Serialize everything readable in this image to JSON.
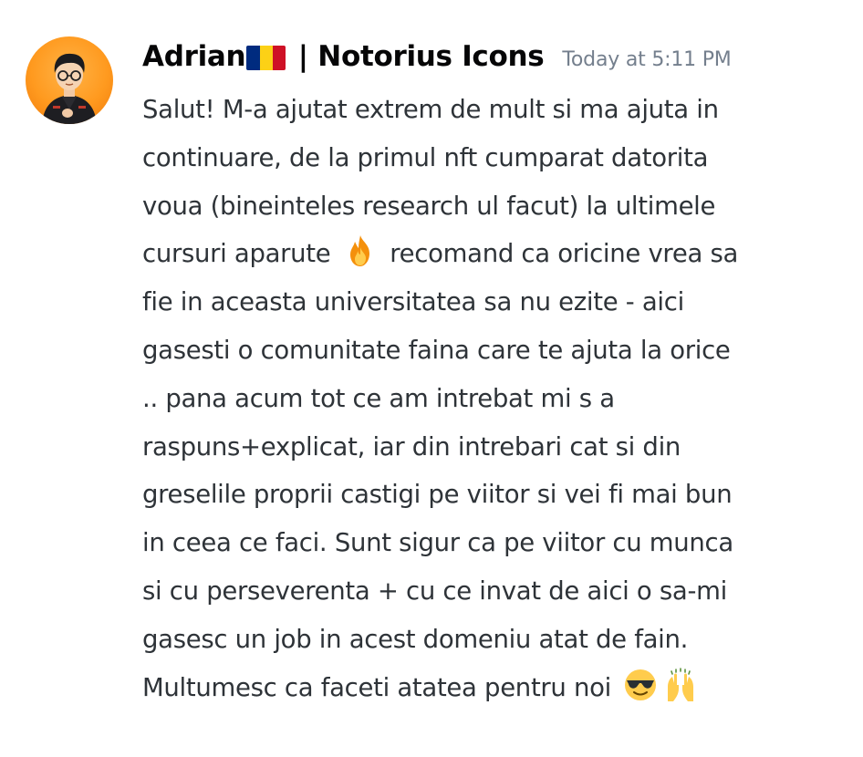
{
  "message": {
    "author": {
      "name_prefix": "Adrian",
      "flag_icon": "romania-flag-icon",
      "flag_colors": [
        "#002b7f",
        "#fcd116",
        "#ce1126"
      ],
      "name_suffix": " | Notorius Icons",
      "avatar_icon": "user-avatar"
    },
    "timestamp": "Today at 5:11 PM",
    "lines": [
      "Salut! M-a ajutat extrem de mult si ma ajuta in",
      "continuare, de la primul nft cumparat datorita",
      "voua (bineinteles research ul facut) la ultimele",
      {
        "before": "cursuri aparute ",
        "emoji": "fire-emoji",
        "after": " recomand ca oricine vrea sa"
      },
      "fie in aceasta universitatea sa nu ezite - aici",
      "gasesti o comunitate faina care te ajuta la orice",
      ".. pana acum tot ce am intrebat mi s a",
      "raspuns+explicat, iar din intrebari cat si din",
      "greselile proprii castigi pe viitor si vei fi mai bun",
      "in ceea ce faci. Sunt sigur ca pe viitor cu munca",
      "si cu perseverenta + cu ce invat de aici o sa-mi",
      "gasesc un job in acest domeniu atat de fain.",
      {
        "before": "Multumesc ca faceti atatea pentru noi ",
        "emoji": "sunglasses-emoji",
        "emoji2": "raising-hands-emoji"
      }
    ]
  },
  "colors": {
    "username": "#060607",
    "text": "#2e3338",
    "timestamp": "#747f8d",
    "avatar_bg": "#ff9a1f"
  }
}
